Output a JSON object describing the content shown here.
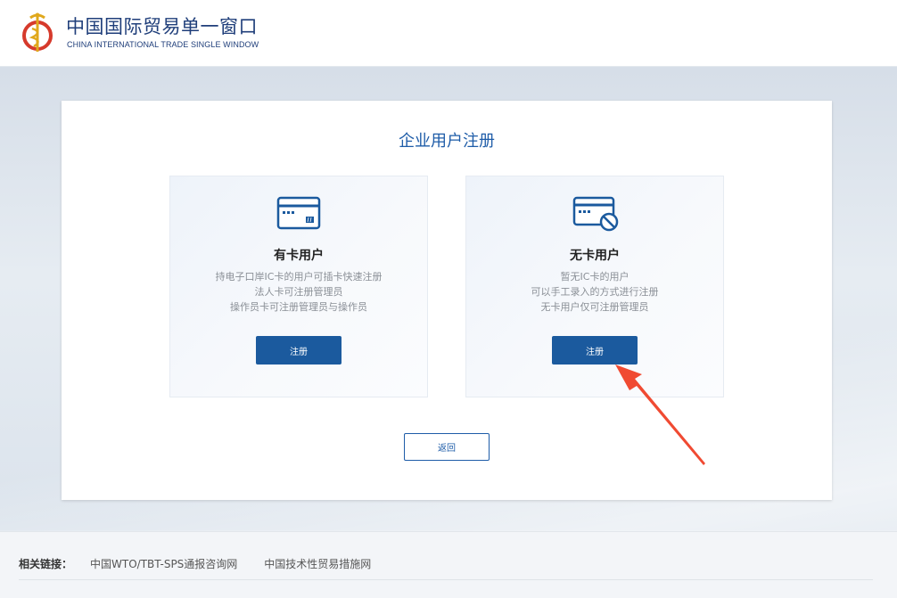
{
  "header": {
    "title_cn": "中国国际贸易单一窗口",
    "title_en": "CHINA INTERNATIONAL TRADE SINGLE WINDOW"
  },
  "main": {
    "title": "企业用户注册",
    "cards": [
      {
        "title": "有卡用户",
        "icon": "ic-card-icon",
        "desc": [
          "持电子口岸IC卡的用户可插卡快速注册",
          "法人卡可注册管理员",
          "操作员卡可注册管理员与操作员"
        ],
        "button": "注册"
      },
      {
        "title": "无卡用户",
        "icon": "no-card-icon",
        "desc": [
          "暂无IC卡的用户",
          "可以手工录入的方式进行注册",
          "无卡用户仅可注册管理员"
        ],
        "button": "注册"
      }
    ],
    "back_button": "返回"
  },
  "footer": {
    "label": "相关链接：",
    "links": [
      "中国WTO/TBT-SPS通报咨询网",
      "中国技术性贸易措施网"
    ]
  },
  "colors": {
    "primary": "#1b5a9e",
    "title_blue": "#1e5ca8",
    "annotation_arrow": "#f04a32"
  }
}
